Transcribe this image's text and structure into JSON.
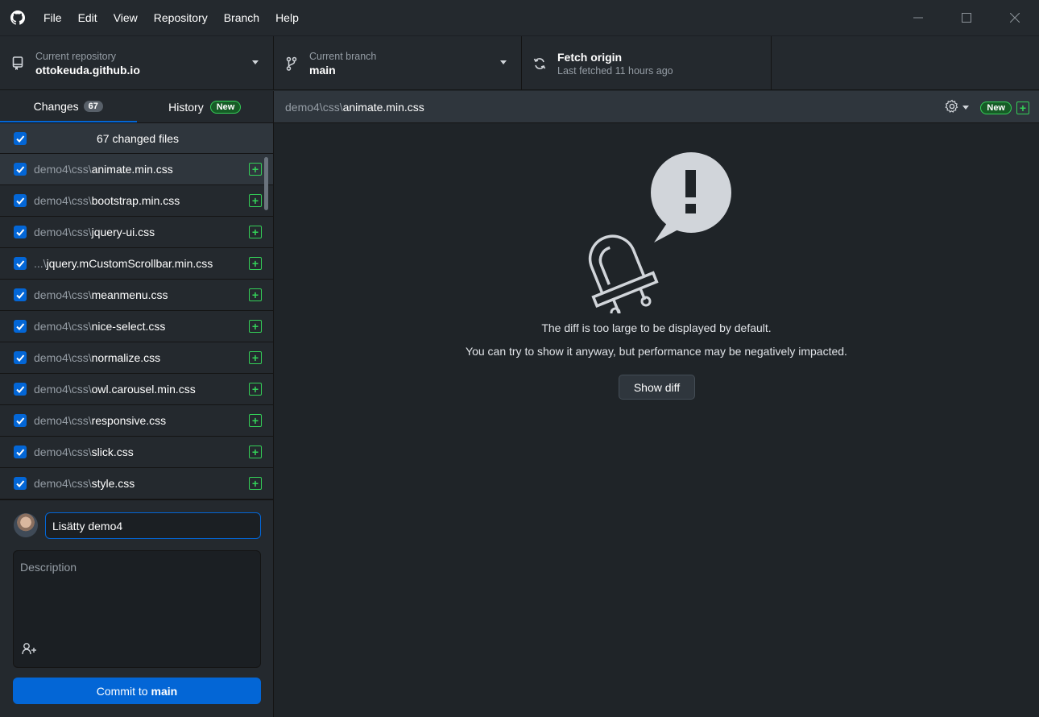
{
  "menu": [
    "File",
    "Edit",
    "View",
    "Repository",
    "Branch",
    "Help"
  ],
  "toolbar": {
    "repo": {
      "sub": "Current repository",
      "main": "ottokeuda.github.io"
    },
    "branch": {
      "sub": "Current branch",
      "main": "main"
    },
    "fetch": {
      "main": "Fetch origin",
      "sub": "Last fetched 11 hours ago"
    }
  },
  "tabs": {
    "changes": {
      "label": "Changes",
      "count": "67"
    },
    "history": {
      "label": "History",
      "badge": "New"
    }
  },
  "changes": {
    "summary": "67 changed files",
    "files": [
      {
        "dir": "demo4\\css\\",
        "name": "animate.min.css"
      },
      {
        "dir": "demo4\\css\\",
        "name": "bootstrap.min.css"
      },
      {
        "dir": "demo4\\css\\",
        "name": "jquery-ui.css"
      },
      {
        "dir": "...\\",
        "name": "jquery.mCustomScrollbar.min.css"
      },
      {
        "dir": "demo4\\css\\",
        "name": "meanmenu.css"
      },
      {
        "dir": "demo4\\css\\",
        "name": "nice-select.css"
      },
      {
        "dir": "demo4\\css\\",
        "name": "normalize.css"
      },
      {
        "dir": "demo4\\css\\",
        "name": "owl.carousel.min.css"
      },
      {
        "dir": "demo4\\css\\",
        "name": "responsive.css"
      },
      {
        "dir": "demo4\\css\\",
        "name": "slick.css"
      },
      {
        "dir": "demo4\\css\\",
        "name": "style.css"
      }
    ]
  },
  "commit": {
    "summary_value": "Lisätty demo4",
    "description_placeholder": "Description",
    "button_prefix": "Commit to",
    "button_branch": "main"
  },
  "diff": {
    "path_dir": "demo4\\css\\",
    "path_name": "animate.min.css",
    "badge": "New",
    "message_line1": "The diff is too large to be displayed by default.",
    "message_line2": "You can try to show it anyway, but performance may be negatively impacted.",
    "show_diff_label": "Show diff"
  },
  "colors": {
    "accent": "#0366d6",
    "added": "#34d058",
    "background": "#24292e"
  }
}
